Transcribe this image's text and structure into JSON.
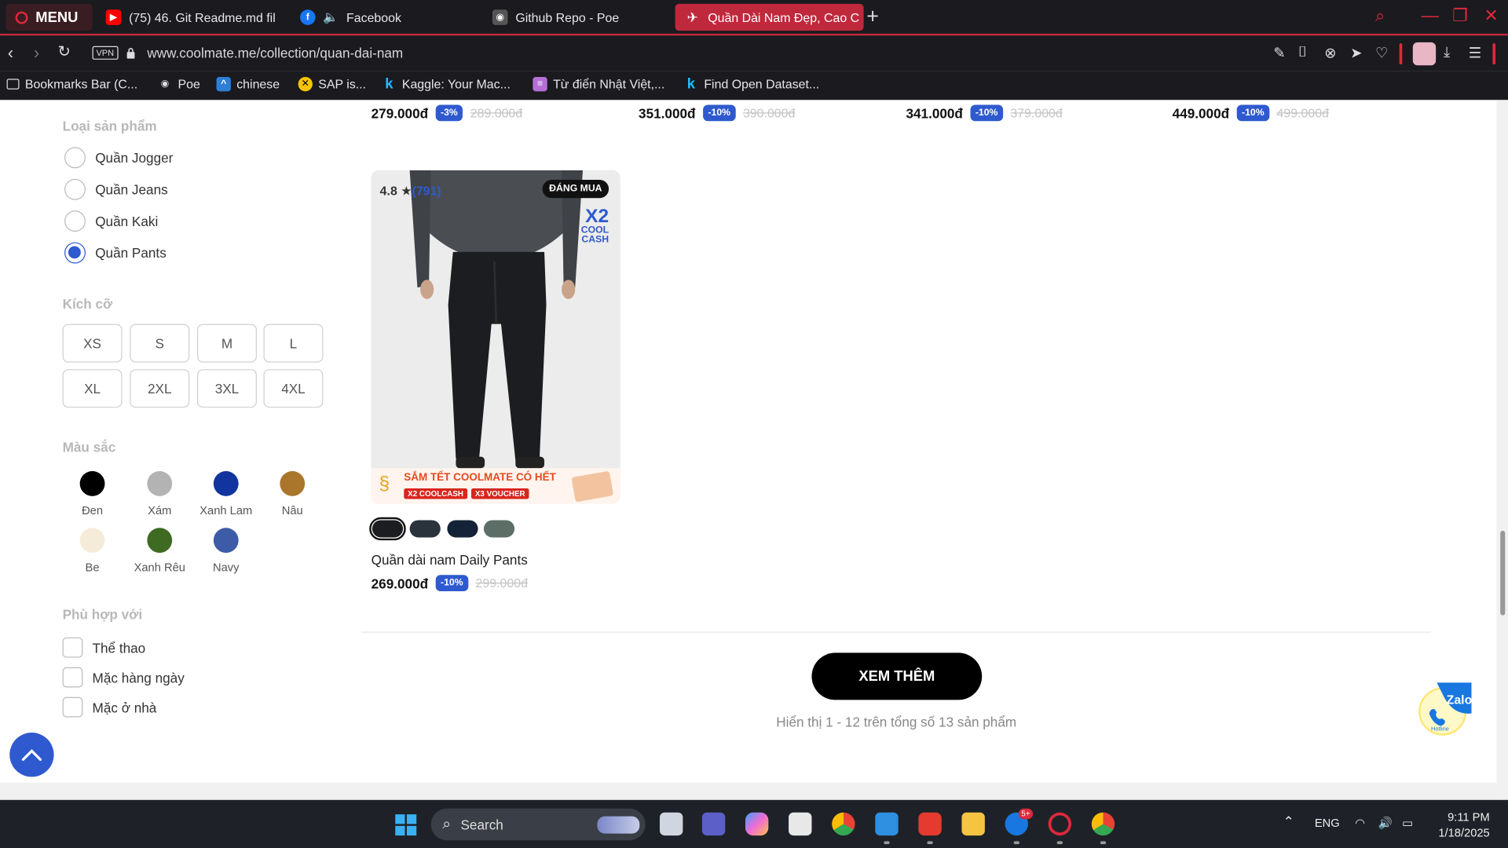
{
  "browser": {
    "menu_label": "MENU",
    "tabs": [
      {
        "title": "(75) 46. Git Readme.md fil"
      },
      {
        "title": "Facebook"
      },
      {
        "title": "Github Repo - Poe"
      },
      {
        "title": "Quần Dài Nam Đẹp, Cao C"
      }
    ],
    "vpn_label": "VPN",
    "url": "www.coolmate.me/collection/quan-dai-nam",
    "bookmarks": [
      {
        "label": "Bookmarks Bar (C..."
      },
      {
        "label": "Poe"
      },
      {
        "label": "chinese"
      },
      {
        "label": "SAP is..."
      },
      {
        "label": "Kaggle: Your Mac..."
      },
      {
        "label": "Từ điển Nhật Việt,..."
      },
      {
        "label": "Find Open Dataset..."
      }
    ]
  },
  "filters": {
    "type_title": "Loại sản phẩm",
    "types": [
      {
        "label": "Quần Jogger",
        "checked": false
      },
      {
        "label": "Quần Jeans",
        "checked": false
      },
      {
        "label": "Quần Kaki",
        "checked": false
      },
      {
        "label": "Quần Pants",
        "checked": true
      }
    ],
    "size_title": "Kích cỡ",
    "sizes": [
      "XS",
      "S",
      "M",
      "L",
      "XL",
      "2XL",
      "3XL",
      "4XL"
    ],
    "color_title": "Màu sắc",
    "colors": [
      {
        "label": "Đen",
        "hex": "#000000"
      },
      {
        "label": "Xám",
        "hex": "#b3b3b3"
      },
      {
        "label": "Xanh Lam",
        "hex": "#12349e"
      },
      {
        "label": "Nâu",
        "hex": "#a9762c"
      },
      {
        "label": "Be",
        "hex": "#f4ecd8"
      },
      {
        "label": "Xanh Rêu",
        "hex": "#3f6a22"
      },
      {
        "label": "Navy",
        "hex": "#3e5ba8"
      }
    ],
    "fit_title": "Phù hợp với",
    "fits": [
      {
        "label": "Thể thao"
      },
      {
        "label": "Mặc hàng ngày"
      },
      {
        "label": "Mặc ở nhà"
      }
    ]
  },
  "top_prices": [
    {
      "price": "279.000đ",
      "discount": "-3%",
      "old": "289.000đ"
    },
    {
      "price": "351.000đ",
      "discount": "-10%",
      "old": "390.000đ"
    },
    {
      "price": "341.000đ",
      "discount": "-10%",
      "old": "379.000đ"
    },
    {
      "price": "449.000đ",
      "discount": "-10%",
      "old": "499.000đ"
    }
  ],
  "product": {
    "rating": "4.8",
    "star": "★",
    "reviews": "(791)",
    "badge": "ĐÁNG MUA",
    "promo_x2": "X2",
    "promo_cool": "COOL",
    "promo_cash": "CASH",
    "banner_title": "SẮM TẾT COOLMATE CÓ HẾT",
    "banner_tag1": "X2 COOLCASH",
    "banner_tag2": "X3 VOUCHER",
    "variants": [
      "#1c1d20",
      "#2a323c",
      "#142338",
      "#5d6e66"
    ],
    "name": "Quần dài nam Daily Pants",
    "price": "269.000đ",
    "discount": "-10%",
    "old_price": "299.000đ"
  },
  "more_button": "XEM THÊM",
  "showing_text": "Hiển thị 1 - 12 trên tổng số 13 sản phẩm",
  "zalo": {
    "label": "Zalo",
    "hotline": "Hotline"
  },
  "taskbar": {
    "search_label": "Search",
    "lang": "ENG",
    "time": "9:11 PM",
    "date": "1/18/2025",
    "badge": "5+"
  },
  "accent": "#2f5acf",
  "brand_red": "#c0283c"
}
